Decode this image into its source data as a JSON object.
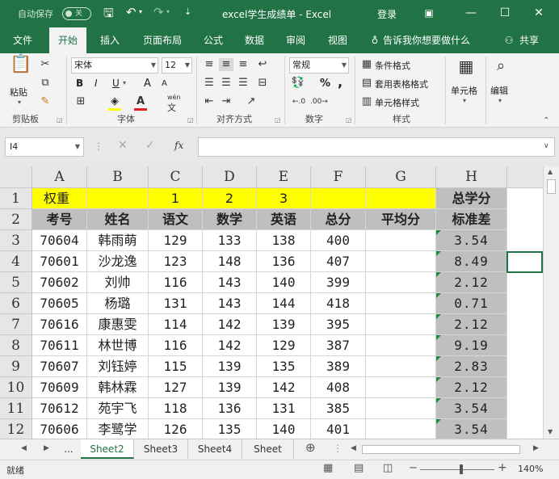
{
  "titlebar": {
    "autosave_label": "自动保存",
    "autosave_state": "关",
    "title": "excel学生成绩单  -  Excel",
    "login": "登录",
    "minimize": "—",
    "maximize": "☐",
    "close": "✕"
  },
  "tabs": [
    {
      "label": "文件"
    },
    {
      "label": "开始"
    },
    {
      "label": "插入"
    },
    {
      "label": "页面布局"
    },
    {
      "label": "公式"
    },
    {
      "label": "数据"
    },
    {
      "label": "审阅"
    },
    {
      "label": "视图"
    }
  ],
  "tell_me": "告诉我你想要做什么",
  "share": "共享",
  "ribbon": {
    "clipboard": {
      "paste": "粘贴",
      "label": "剪贴板"
    },
    "font": {
      "name": "宋体",
      "size": "12",
      "label": "字体",
      "bold": "B",
      "italic": "I",
      "underline": "U",
      "grow": "A",
      "shrink": "A",
      "wen": "wén",
      "zi": "文"
    },
    "alignment": {
      "label": "对齐方式"
    },
    "number": {
      "format": "常规",
      "label": "数字",
      "percent": "%",
      "comma": ","
    },
    "styles": {
      "conditional": "条件格式",
      "table": "套用表格格式",
      "cell": "单元格样式",
      "label": "样式"
    },
    "cells": {
      "label": "单元格"
    },
    "editing": {
      "label": "编辑"
    }
  },
  "formula_bar": {
    "name_box": "I4",
    "fx": "fx",
    "content": ""
  },
  "columns": [
    "A",
    "B",
    "C",
    "D",
    "E",
    "F",
    "G",
    "H"
  ],
  "rows": [
    [
      "权重",
      "",
      "1",
      "2",
      "3",
      "",
      "",
      "总学分"
    ],
    [
      "考号",
      "姓名",
      "语文",
      "数学",
      "英语",
      "总分",
      "平均分",
      "标准差"
    ],
    [
      "70604",
      "韩雨萌",
      "129",
      "133",
      "138",
      "400",
      "",
      "3.54"
    ],
    [
      "70601",
      "沙龙逸",
      "123",
      "148",
      "136",
      "407",
      "",
      "8.49"
    ],
    [
      "70602",
      "刘帅",
      "116",
      "143",
      "140",
      "399",
      "",
      "2.12"
    ],
    [
      "70605",
      "杨璐",
      "131",
      "143",
      "144",
      "418",
      "",
      "0.71"
    ],
    [
      "70616",
      "康惠雯",
      "114",
      "142",
      "139",
      "395",
      "",
      "2.12"
    ],
    [
      "70611",
      "林世博",
      "116",
      "142",
      "129",
      "387",
      "",
      "9.19"
    ],
    [
      "70607",
      "刘钰婷",
      "115",
      "139",
      "135",
      "389",
      "",
      "2.83"
    ],
    [
      "70609",
      "韩林霖",
      "127",
      "139",
      "142",
      "408",
      "",
      "2.12"
    ],
    [
      "70612",
      "苑宇飞",
      "118",
      "136",
      "131",
      "385",
      "",
      "3.54"
    ],
    [
      "70606",
      "李鹭学",
      "126",
      "135",
      "140",
      "401",
      "",
      "3.54"
    ]
  ],
  "row_numbers": [
    "1",
    "2",
    "3",
    "4",
    "5",
    "6",
    "7",
    "8",
    "9",
    "10",
    "11",
    "12"
  ],
  "sheet_tabs": [
    "...",
    "Sheet2",
    "Sheet3",
    "Sheet4",
    "Sheet"
  ],
  "status": {
    "ready": "就绪",
    "zoom": "140%"
  },
  "colors": {
    "accent": "#217346",
    "highlight": "#ffff00",
    "header_gray": "#bfbfbf",
    "error_flag": "#1e8a3a"
  }
}
